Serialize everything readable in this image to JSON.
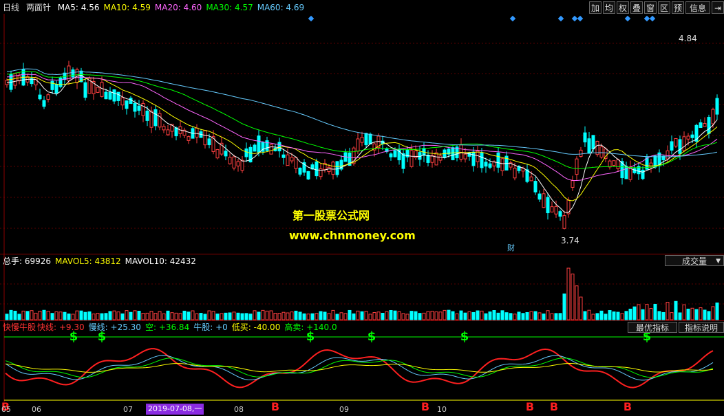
{
  "main_header": {
    "period": "日线",
    "name": "两面针",
    "ma": [
      {
        "label": "MA5:",
        "value": "4.56",
        "color": "#ffffff"
      },
      {
        "label": "MA10:",
        "value": "4.59",
        "color": "#ffff00"
      },
      {
        "label": "MA20:",
        "value": "4.60",
        "color": "#ff66ff"
      },
      {
        "label": "MA30:",
        "value": "4.57",
        "color": "#00ff00"
      },
      {
        "label": "MA60:",
        "value": "4.69",
        "color": "#66ccff"
      }
    ]
  },
  "toolbar": [
    "加",
    "均",
    "权",
    "叠",
    "窗",
    "区",
    "预",
    "信息"
  ],
  "price_labels": {
    "high": "4.84",
    "low": "3.74",
    "cai": "财"
  },
  "watermark": {
    "line1": "第一股票公式网",
    "line2": "www.chnmoney.com"
  },
  "volume_header": {
    "items": [
      {
        "label": "总手:",
        "value": "69926",
        "color": "#ffffff"
      },
      {
        "label": "MAVOL5:",
        "value": "43812",
        "color": "#ffff00"
      },
      {
        "label": "MAVOL10:",
        "value": "42432",
        "color": "#ffffff"
      }
    ],
    "button": "成交量"
  },
  "indicator_header": {
    "name": "快慢牛股",
    "items": [
      {
        "label": "快线:",
        "value": "+9.30",
        "color": "#ff3333"
      },
      {
        "label": "慢线:",
        "value": "+25.30",
        "color": "#66ccff"
      },
      {
        "label": "空:",
        "value": "+36.84",
        "color": "#00ff00"
      },
      {
        "label": "牛股:",
        "value": "+0",
        "color": "#66ccff"
      },
      {
        "label": "低买:",
        "value": "-40.00",
        "color": "#ffff00"
      },
      {
        "label": "高卖:",
        "value": "+140.0",
        "color": "#00ff00"
      }
    ],
    "buttons": [
      "最优指标",
      "指标说明"
    ]
  },
  "axis": {
    "months": [
      "05",
      "06",
      "07",
      "08",
      "09",
      "10"
    ],
    "cursor_date": "2019-07-08,一"
  },
  "signals": {
    "sell": "$",
    "buy": "B"
  }
}
